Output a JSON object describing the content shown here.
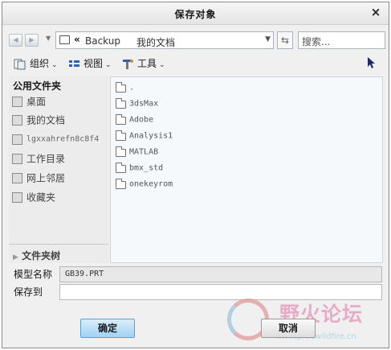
{
  "dialog": {
    "title": "保存对象",
    "close_glyph": "×"
  },
  "nav": {
    "back_glyph": "◀",
    "forward_glyph": "▶",
    "dropdown_glyph": "▼"
  },
  "address": {
    "chevron": "«",
    "crumbs": [
      "Backup",
      "我的文档"
    ],
    "dropdown_glyph": "▼"
  },
  "refresh": {
    "glyph": "⇆"
  },
  "search": {
    "placeholder": "搜索..."
  },
  "toolbar": {
    "organize_label": "组织",
    "view_label": "视图",
    "tools_label": "工具",
    "caret": "⌄",
    "help_glyph": "?"
  },
  "sidebar": {
    "header": "公用文件夹",
    "items": [
      {
        "label": "桌面",
        "icon": "desktop-icon"
      },
      {
        "label": "我的文档",
        "icon": "documents-icon"
      },
      {
        "label": "lgxxahrefn8c8f4",
        "icon": "computer-icon"
      },
      {
        "label": "工作目录",
        "icon": "working-directory-icon"
      },
      {
        "label": "网上邻居",
        "icon": "network-icon"
      },
      {
        "label": "收藏夹",
        "icon": "favorites-icon"
      }
    ],
    "tree_toggle_glyph": "▶",
    "tree_label": "文件夹树"
  },
  "files": [
    ".",
    "3dsMax",
    "Adobe",
    "Analysis1",
    "MATLAB",
    "bmx_std",
    "onekeyrom"
  ],
  "form": {
    "model_name_label": "模型名称",
    "model_name_value": "GB39.PRT",
    "save_to_label": "保存到",
    "save_to_value": ""
  },
  "buttons": {
    "ok": "确定",
    "cancel": "取消"
  },
  "watermark": {
    "brand": "野火论坛",
    "url": "www.proewildfire.cn"
  }
}
